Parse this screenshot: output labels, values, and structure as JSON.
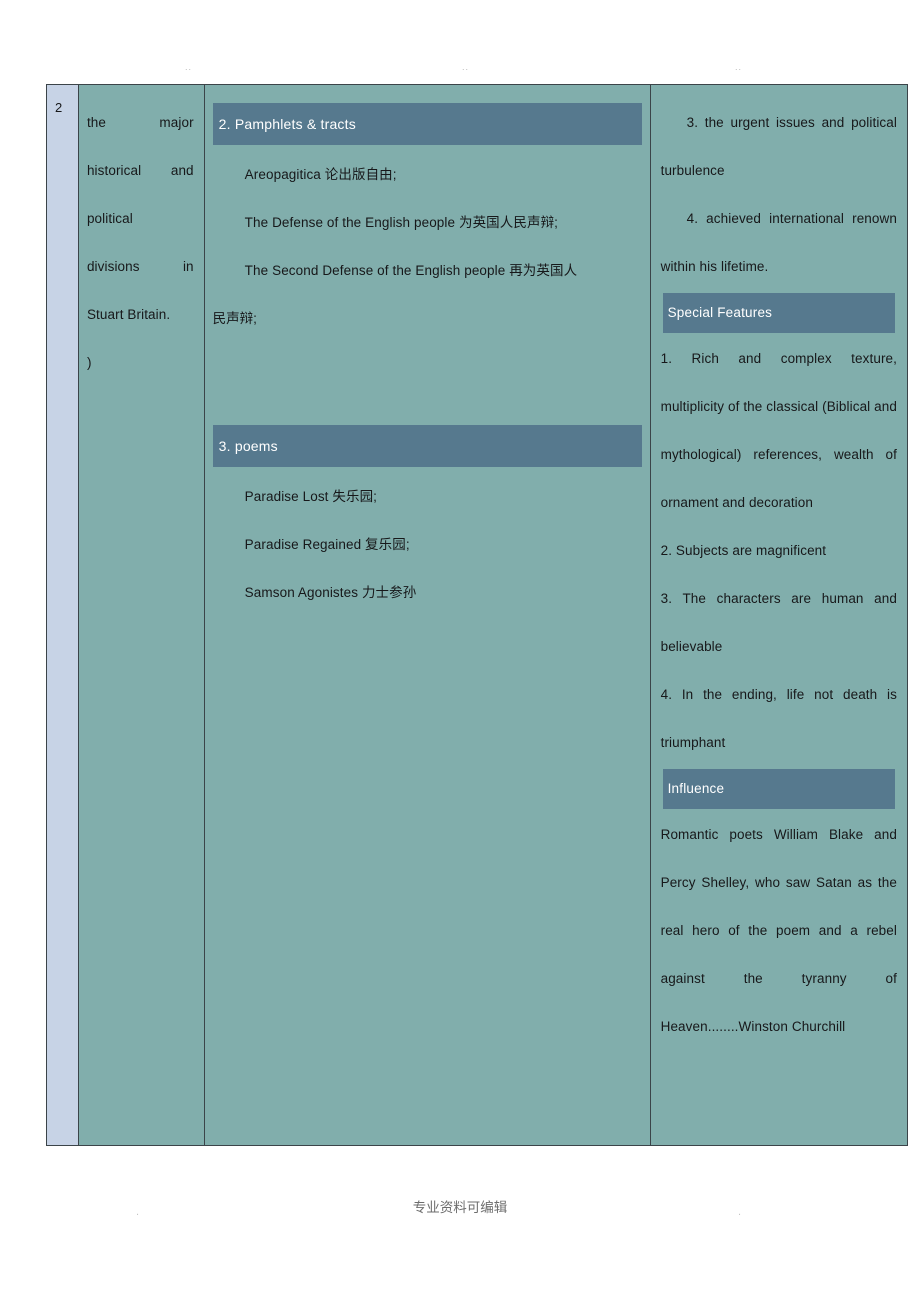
{
  "page": {
    "top_marks": [
      "..",
      "..",
      ".."
    ],
    "footer": {
      "center_text": "专业资料可编辑",
      "left_dot": ".",
      "right_dot": "."
    }
  },
  "colors": {
    "cell_background": "#81aeac",
    "band_background": "#56798e",
    "row_number_background": "#c7d3e6",
    "border": "#3b4449",
    "band_text": "#ffffff",
    "body_text": "#17181a"
  },
  "table": {
    "row_number": "2",
    "column_left": {
      "lines": [
        "the        major",
        "historical   and",
        "political",
        "divisions      in",
        "Stuart Britain.",
        ")"
      ],
      "text": "the major historical and political divisions in Stuart Britain. )"
    },
    "column_middle": {
      "sections": [
        {
          "heading": "2. Pamphlets & tracts",
          "entries": [
            "Areopagitica 论出版自由;",
            "The Defense of the English people 为英国人民声辩;",
            "The Second Defense of the English people 再为英国人",
            "民声辩;"
          ]
        },
        {
          "heading": "3. poems",
          "entries": [
            "Paradise Lost 失乐园;",
            "Paradise Regained 复乐园;",
            "Samson Agonistes 力士参孙"
          ]
        }
      ]
    },
    "column_right": {
      "top_points": [
        "3. the urgent issues and political turbulence",
        "4. achieved international renown within his lifetime."
      ],
      "sections": [
        {
          "heading": "Special Features",
          "points": [
            "1. Rich and complex texture, multiplicity of the classical (Biblical and mythological) references, wealth of ornament and decoration",
            "2. Subjects are magnificent",
            "3. The characters are human and believable",
            "4. In the ending, life not death is triumphant"
          ]
        },
        {
          "heading": "Influence",
          "points": [
            "Romantic poets William Blake and Percy Shelley, who saw Satan as the real hero of the poem and a rebel against the tyranny of Heaven........Winston Churchill"
          ]
        }
      ]
    }
  }
}
